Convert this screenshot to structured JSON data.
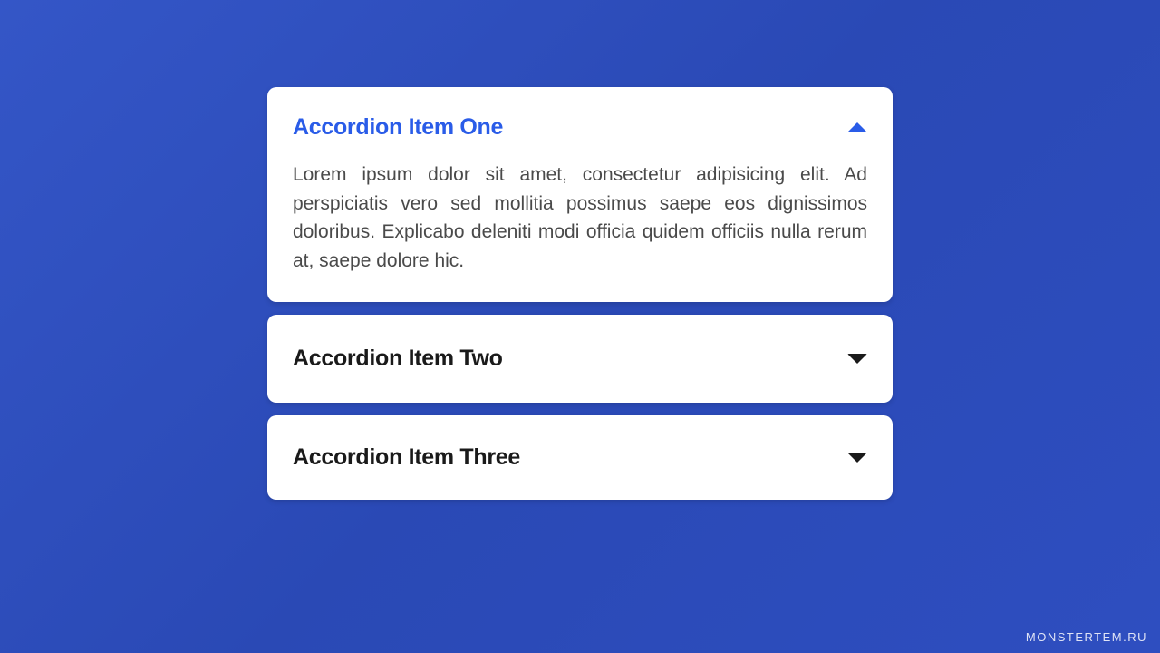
{
  "accordion": {
    "items": [
      {
        "title": "Accordion Item One",
        "expanded": true,
        "content": "Lorem ipsum dolor sit amet, consectetur adipisicing elit. Ad perspiciatis vero sed mollitia possimus saepe eos dignissimos doloribus. Explicabo deleniti modi officia quidem officiis nulla rerum at, saepe dolore hic."
      },
      {
        "title": "Accordion Item Two",
        "expanded": false
      },
      {
        "title": "Accordion Item Three",
        "expanded": false
      }
    ]
  },
  "watermark": "MONSTERTEM.RU",
  "colors": {
    "accent": "#2a5ce8",
    "background_start": "#3456c7",
    "background_end": "#2e4ec0"
  }
}
